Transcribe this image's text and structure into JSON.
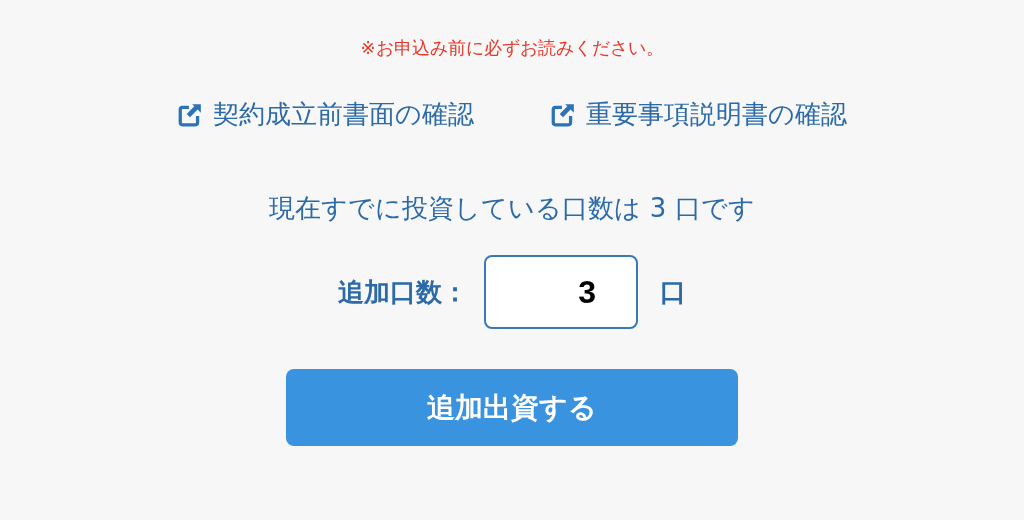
{
  "notice": "※お申込み前に必ずお読みください。",
  "links": [
    {
      "label": "契約成立前書面の確認"
    },
    {
      "label": "重要事項説明書の確認"
    }
  ],
  "status": "現在すでに投資している口数は 3 口です",
  "units_field": {
    "label": "追加口数：",
    "value": "3",
    "unit": "口"
  },
  "submit_button": "追加出資する"
}
